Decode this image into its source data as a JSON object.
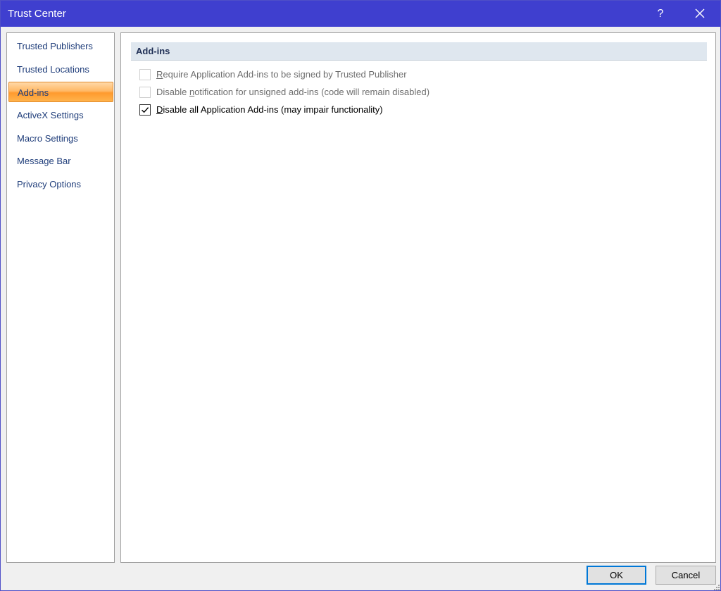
{
  "window": {
    "title": "Trust Center",
    "help_label": "?"
  },
  "sidebar": {
    "items": [
      {
        "label": "Trusted Publishers",
        "selected": false
      },
      {
        "label": "Trusted Locations",
        "selected": false
      },
      {
        "label": "Add-ins",
        "selected": true
      },
      {
        "label": "ActiveX Settings",
        "selected": false
      },
      {
        "label": "Macro Settings",
        "selected": false
      },
      {
        "label": "Message Bar",
        "selected": false
      },
      {
        "label": "Privacy Options",
        "selected": false
      }
    ]
  },
  "main": {
    "section_title": "Add-ins",
    "options": [
      {
        "prefix": "",
        "accel": "R",
        "suffix": "equire Application Add-ins to be signed by Trusted Publisher",
        "checked": false,
        "enabled": false
      },
      {
        "prefix": "Disable ",
        "accel": "n",
        "suffix": "otification for unsigned add-ins (code will remain disabled)",
        "checked": false,
        "enabled": false
      },
      {
        "prefix": "",
        "accel": "D",
        "suffix": "isable all Application Add-ins (may impair functionality)",
        "checked": true,
        "enabled": true
      }
    ]
  },
  "footer": {
    "ok_label": "OK",
    "cancel_label": "Cancel"
  },
  "colors": {
    "titlebar": "#3f3fcf",
    "nav_text": "#1f3d7a",
    "selected_item": "#ffb866",
    "section_header_bg": "#dfe7ef",
    "ok_border": "#0078d7"
  }
}
